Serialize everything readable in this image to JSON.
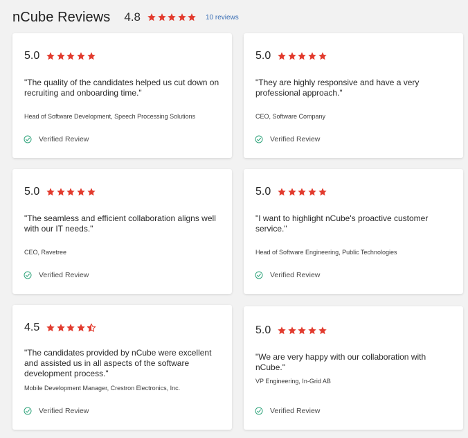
{
  "header": {
    "title": "nCube Reviews",
    "score": "4.8",
    "stars": 5,
    "count_label": "10 reviews"
  },
  "colors": {
    "star": "#e23b2e",
    "check": "#2ea37a",
    "link": "#3b6fb5"
  },
  "icons": {
    "star": "star-icon",
    "half_star": "half-star-icon",
    "verified": "check-circle-icon"
  },
  "reviews": [
    {
      "score": "5.0",
      "stars": 5,
      "quote": "\"The quality of the candidates helped us cut down on recruiting and onboarding time.\"",
      "author": "Head of Software Development, Speech Processing Solutions",
      "verified": "Verified Review"
    },
    {
      "score": "5.0",
      "stars": 5,
      "quote": "\"They are highly responsive and have a very professional approach.\"",
      "author": "CEO, Software Company",
      "verified": "Verified Review"
    },
    {
      "score": "5.0",
      "stars": 5,
      "quote": "\"The seamless and efficient collaboration aligns well with our IT needs.\"",
      "author": "CEO, Ravetree",
      "verified": "Verified Review"
    },
    {
      "score": "5.0",
      "stars": 5,
      "quote": "\"I want to highlight nCube's proactive customer service.\"",
      "author": "Head of Software Engineering, Public Technologies",
      "verified": "Verified Review"
    },
    {
      "score": "4.5",
      "stars": 4.5,
      "quote": "\"The candidates provided by nCube were excellent and assisted us in all aspects of the software development process.\"",
      "author": "Mobile Development Manager, Crestron Electronics, Inc.",
      "verified": "Verified Review"
    },
    {
      "score": "5.0",
      "stars": 5,
      "quote": "\"We are very happy with our collaboration with nCube.\"",
      "author": "VP Engineering, In-Grid AB",
      "verified": "Verified Review"
    }
  ]
}
